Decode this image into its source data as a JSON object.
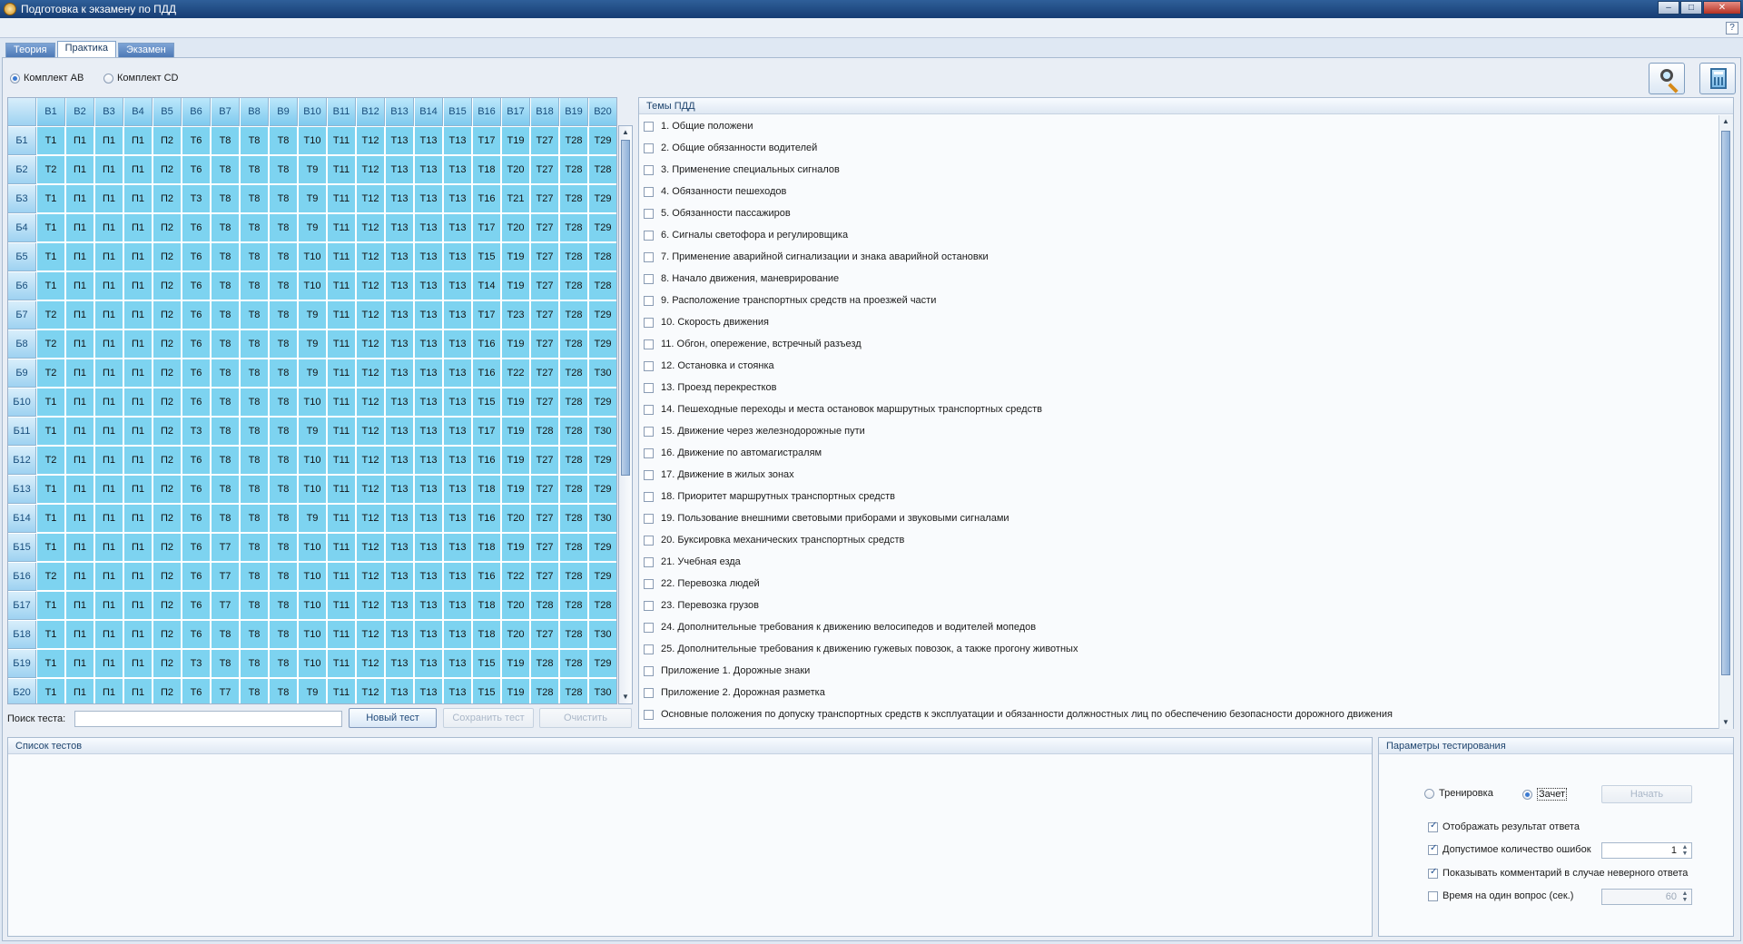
{
  "window": {
    "title": "Подготовка к экзамену по ПДД"
  },
  "tabs": [
    "Теория",
    "Практика",
    "Экзамен"
  ],
  "sets": {
    "ab": "Комплект AB",
    "cd": "Комплект CD",
    "selected": "ab"
  },
  "grid": {
    "columns": [
      "B1",
      "B2",
      "B3",
      "B4",
      "B5",
      "B6",
      "B7",
      "B8",
      "B9",
      "B10",
      "B11",
      "B12",
      "B13",
      "B14",
      "B15",
      "B16",
      "B17",
      "B18",
      "B19",
      "B20"
    ],
    "rows": [
      {
        "label": "Б1",
        "cells": [
          "Т1",
          "П1",
          "П1",
          "П1",
          "П2",
          "Т6",
          "Т8",
          "Т8",
          "Т8",
          "Т10",
          "Т11",
          "Т12",
          "Т13",
          "Т13",
          "Т13",
          "Т17",
          "Т19",
          "Т27",
          "Т28",
          "Т29"
        ]
      },
      {
        "label": "Б2",
        "cells": [
          "Т2",
          "П1",
          "П1",
          "П1",
          "П2",
          "Т6",
          "Т8",
          "Т8",
          "Т8",
          "Т9",
          "Т11",
          "Т12",
          "Т13",
          "Т13",
          "Т13",
          "Т18",
          "Т20",
          "Т27",
          "Т28",
          "Т28"
        ]
      },
      {
        "label": "Б3",
        "cells": [
          "Т1",
          "П1",
          "П1",
          "П1",
          "П2",
          "Т3",
          "Т8",
          "Т8",
          "Т8",
          "Т9",
          "Т11",
          "Т12",
          "Т13",
          "Т13",
          "Т13",
          "Т16",
          "Т21",
          "Т27",
          "Т28",
          "Т29"
        ]
      },
      {
        "label": "Б4",
        "cells": [
          "Т1",
          "П1",
          "П1",
          "П1",
          "П2",
          "Т6",
          "Т8",
          "Т8",
          "Т8",
          "Т9",
          "Т11",
          "Т12",
          "Т13",
          "Т13",
          "Т13",
          "Т17",
          "Т20",
          "Т27",
          "Т28",
          "Т29"
        ]
      },
      {
        "label": "Б5",
        "cells": [
          "Т1",
          "П1",
          "П1",
          "П1",
          "П2",
          "Т6",
          "Т8",
          "Т8",
          "Т8",
          "Т10",
          "Т11",
          "Т12",
          "Т13",
          "Т13",
          "Т13",
          "Т15",
          "Т19",
          "Т27",
          "Т28",
          "Т28"
        ]
      },
      {
        "label": "Б6",
        "cells": [
          "Т1",
          "П1",
          "П1",
          "П1",
          "П2",
          "Т6",
          "Т8",
          "Т8",
          "Т8",
          "Т10",
          "Т11",
          "Т12",
          "Т13",
          "Т13",
          "Т13",
          "Т14",
          "Т19",
          "Т27",
          "Т28",
          "Т28"
        ]
      },
      {
        "label": "Б7",
        "cells": [
          "Т2",
          "П1",
          "П1",
          "П1",
          "П2",
          "Т6",
          "Т8",
          "Т8",
          "Т8",
          "Т9",
          "Т11",
          "Т12",
          "Т13",
          "Т13",
          "Т13",
          "Т17",
          "Т23",
          "Т27",
          "Т28",
          "Т29"
        ]
      },
      {
        "label": "Б8",
        "cells": [
          "Т2",
          "П1",
          "П1",
          "П1",
          "П2",
          "Т6",
          "Т8",
          "Т8",
          "Т8",
          "Т9",
          "Т11",
          "Т12",
          "Т13",
          "Т13",
          "Т13",
          "Т16",
          "Т19",
          "Т27",
          "Т28",
          "Т29"
        ]
      },
      {
        "label": "Б9",
        "cells": [
          "Т2",
          "П1",
          "П1",
          "П1",
          "П2",
          "Т6",
          "Т8",
          "Т8",
          "Т8",
          "Т9",
          "Т11",
          "Т12",
          "Т13",
          "Т13",
          "Т13",
          "Т16",
          "Т22",
          "Т27",
          "Т28",
          "Т30"
        ]
      },
      {
        "label": "Б10",
        "cells": [
          "Т1",
          "П1",
          "П1",
          "П1",
          "П2",
          "Т6",
          "Т8",
          "Т8",
          "Т8",
          "Т10",
          "Т11",
          "Т12",
          "Т13",
          "Т13",
          "Т13",
          "Т15",
          "Т19",
          "Т27",
          "Т28",
          "Т29"
        ]
      },
      {
        "label": "Б11",
        "cells": [
          "Т1",
          "П1",
          "П1",
          "П1",
          "П2",
          "Т3",
          "Т8",
          "Т8",
          "Т8",
          "Т9",
          "Т11",
          "Т12",
          "Т13",
          "Т13",
          "Т13",
          "Т17",
          "Т19",
          "Т28",
          "Т28",
          "Т30"
        ]
      },
      {
        "label": "Б12",
        "cells": [
          "Т2",
          "П1",
          "П1",
          "П1",
          "П2",
          "Т6",
          "Т8",
          "Т8",
          "Т8",
          "Т10",
          "Т11",
          "Т12",
          "Т13",
          "Т13",
          "Т13",
          "Т16",
          "Т19",
          "Т27",
          "Т28",
          "Т29"
        ]
      },
      {
        "label": "Б13",
        "cells": [
          "Т1",
          "П1",
          "П1",
          "П1",
          "П2",
          "Т6",
          "Т8",
          "Т8",
          "Т8",
          "Т10",
          "Т11",
          "Т12",
          "Т13",
          "Т13",
          "Т13",
          "Т18",
          "Т19",
          "Т27",
          "Т28",
          "Т29"
        ]
      },
      {
        "label": "Б14",
        "cells": [
          "Т1",
          "П1",
          "П1",
          "П1",
          "П2",
          "Т6",
          "Т8",
          "Т8",
          "Т8",
          "Т9",
          "Т11",
          "Т12",
          "Т13",
          "Т13",
          "Т13",
          "Т16",
          "Т20",
          "Т27",
          "Т28",
          "Т30"
        ]
      },
      {
        "label": "Б15",
        "cells": [
          "Т1",
          "П1",
          "П1",
          "П1",
          "П2",
          "Т6",
          "Т7",
          "Т8",
          "Т8",
          "Т10",
          "Т11",
          "Т12",
          "Т13",
          "Т13",
          "Т13",
          "Т18",
          "Т19",
          "Т27",
          "Т28",
          "Т29"
        ]
      },
      {
        "label": "Б16",
        "cells": [
          "Т2",
          "П1",
          "П1",
          "П1",
          "П2",
          "Т6",
          "Т7",
          "Т8",
          "Т8",
          "Т10",
          "Т11",
          "Т12",
          "Т13",
          "Т13",
          "Т13",
          "Т16",
          "Т22",
          "Т27",
          "Т28",
          "Т29"
        ]
      },
      {
        "label": "Б17",
        "cells": [
          "Т1",
          "П1",
          "П1",
          "П1",
          "П2",
          "Т6",
          "Т7",
          "Т8",
          "Т8",
          "Т10",
          "Т11",
          "Т12",
          "Т13",
          "Т13",
          "Т13",
          "Т18",
          "Т20",
          "Т28",
          "Т28",
          "Т28"
        ]
      },
      {
        "label": "Б18",
        "cells": [
          "Т1",
          "П1",
          "П1",
          "П1",
          "П2",
          "Т6",
          "Т8",
          "Т8",
          "Т8",
          "Т10",
          "Т11",
          "Т12",
          "Т13",
          "Т13",
          "Т13",
          "Т18",
          "Т20",
          "Т27",
          "Т28",
          "Т30"
        ]
      },
      {
        "label": "Б19",
        "cells": [
          "Т1",
          "П1",
          "П1",
          "П1",
          "П2",
          "Т3",
          "Т8",
          "Т8",
          "Т8",
          "Т10",
          "Т11",
          "Т12",
          "Т13",
          "Т13",
          "Т13",
          "Т15",
          "Т19",
          "Т28",
          "Т28",
          "Т29"
        ]
      },
      {
        "label": "Б20",
        "cells": [
          "Т1",
          "П1",
          "П1",
          "П1",
          "П2",
          "Т6",
          "Т7",
          "Т8",
          "Т8",
          "Т9",
          "Т11",
          "Т12",
          "Т13",
          "Т13",
          "Т13",
          "Т15",
          "Т19",
          "Т28",
          "Т28",
          "Т30"
        ]
      }
    ]
  },
  "search": {
    "label": "Поиск теста:",
    "value": ""
  },
  "buttons": {
    "new_test": "Новый тест",
    "save_test": "Сохранить тест",
    "clear": "Очистить",
    "start": "Начать"
  },
  "topics": {
    "title": "Темы ПДД",
    "items": [
      "1. Общие положени",
      "2. Общие обязанности водителей",
      "3. Применение специальных сигналов",
      "4. Обязанности пешеходов",
      "5. Обязанности пассажиров",
      "6. Сигналы светофора и регулировщика",
      "7. Применение аварийной сигнализации и знака аварийной остановки",
      "8. Начало движения, маневрирование",
      "9. Расположение транспортных средств на проезжей части",
      "10. Скорость движения",
      "11. Обгон, опережение, встречный разъезд",
      "12. Остановка и стоянка",
      "13. Проезд перекрестков",
      "14. Пешеходные переходы и места остановок маршрутных транспортных средств",
      "15. Движение через железнодорожные пути",
      "16. Движение по автомагистралям",
      "17. Движение в жилых зонах",
      "18. Приоритет маршрутных транспортных средств",
      "19. Пользование внешними световыми приборами и звуковыми сигналами",
      "20. Буксировка механических транспортных средств",
      "21. Учебная езда",
      "22. Перевозка людей",
      "23. Перевозка грузов",
      "24. Дополнительные требования к движению велосипедов и водителей мопедов",
      "25. Дополнительные требования к движению гужевых повозок, а также прогону животных",
      "Приложение 1. Дорожные знаки",
      "Приложение 2. Дорожная разметка",
      "Основные положения по допуску транспортных средств к эксплуатации и обязанности должностных лиц по обеспечению безопасности дорожного движения"
    ]
  },
  "tests": {
    "title": "Список тестов"
  },
  "params": {
    "title": "Параметры тестирования",
    "mode_training": "Тренировка",
    "mode_exam": "Зачет",
    "show_result": "Отображать результат ответа",
    "allowed_errors": "Допустимое количество ошибок",
    "allowed_errors_value": "1",
    "show_comment": "Показывать комментарий в случае неверного ответа",
    "time_per_question": "Время на один вопрос (сек.)",
    "time_value": "60"
  },
  "colors": {
    "cell": "#7dd3f0",
    "header": "#9ed2f1",
    "titlebar": "#163d73"
  },
  "icons": {
    "zoom": "magnifier-icon",
    "calc": "calculator-icon",
    "help": "help-icon"
  }
}
